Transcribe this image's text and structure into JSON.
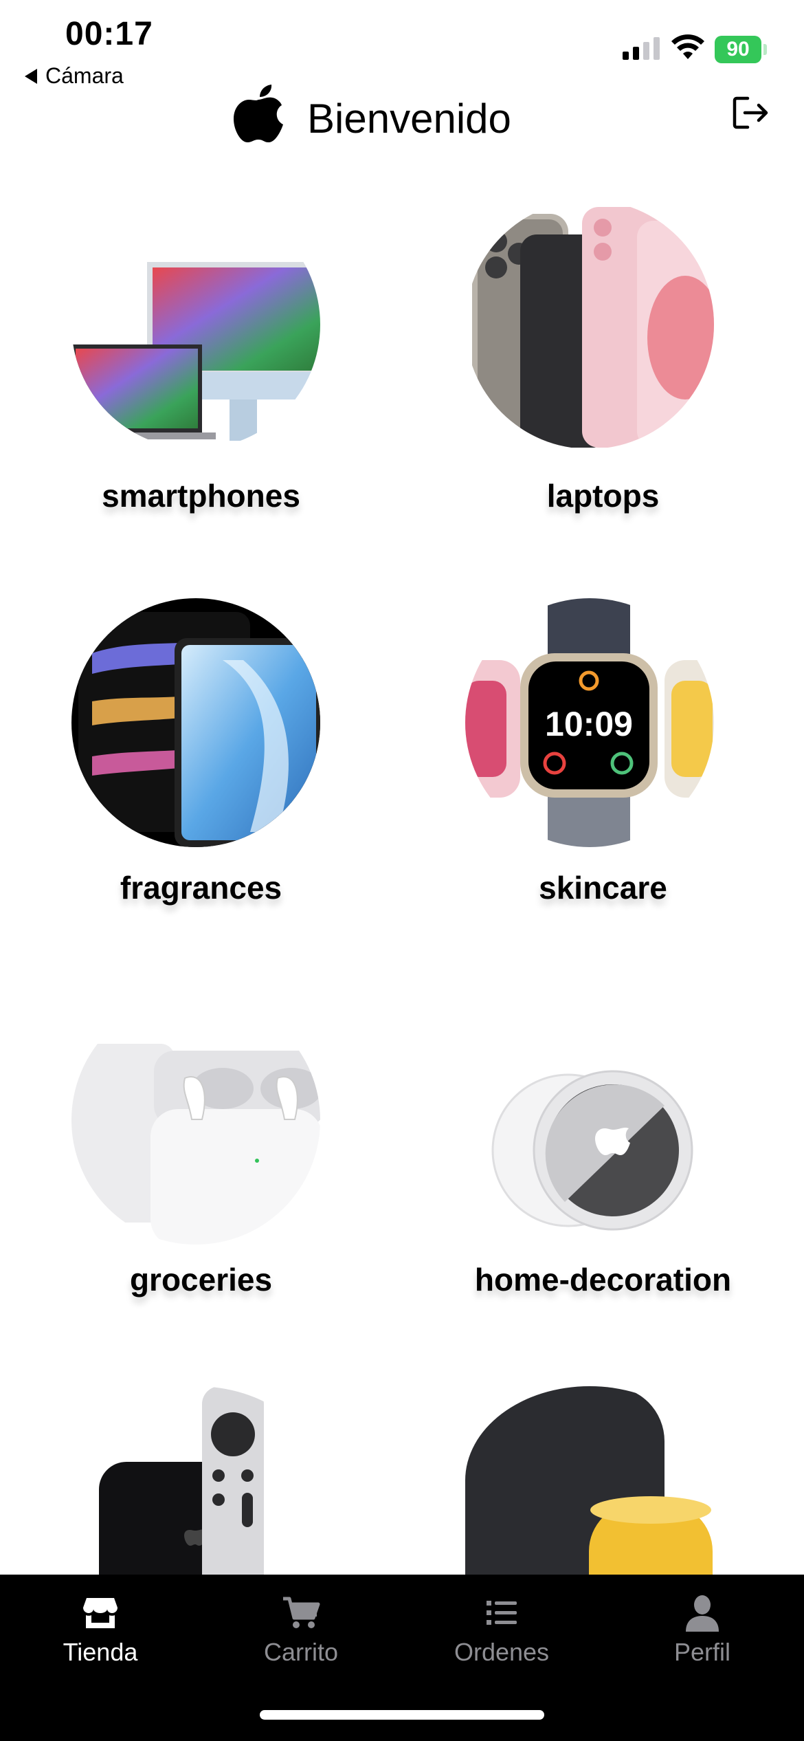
{
  "status_bar": {
    "time": "00:17",
    "back_app": "Cámara",
    "battery": "90"
  },
  "header": {
    "title": "Bienvenido"
  },
  "categories": [
    {
      "label": "smartphones",
      "image": "mac-devices"
    },
    {
      "label": "laptops",
      "image": "iphones"
    },
    {
      "label": "fragrances",
      "image": "ipads"
    },
    {
      "label": "skincare",
      "image": "apple-watches",
      "watch_time": "10:09"
    },
    {
      "label": "groceries",
      "image": "airpods"
    },
    {
      "label": "home-decoration",
      "image": "airtag"
    },
    {
      "label": "",
      "image": "apple-tv"
    },
    {
      "label": "",
      "image": "homepod"
    }
  ],
  "tab_bar": {
    "tabs": [
      {
        "label": "Tienda",
        "icon": "store-icon",
        "active": true
      },
      {
        "label": "Carrito",
        "icon": "cart-icon",
        "active": false
      },
      {
        "label": "Ordenes",
        "icon": "list-icon",
        "active": false
      },
      {
        "label": "Perfil",
        "icon": "person-icon",
        "active": false
      }
    ]
  },
  "colors": {
    "battery": "#34c759",
    "tab_active": "#ffffff",
    "tab_inactive": "#8e8e93"
  }
}
